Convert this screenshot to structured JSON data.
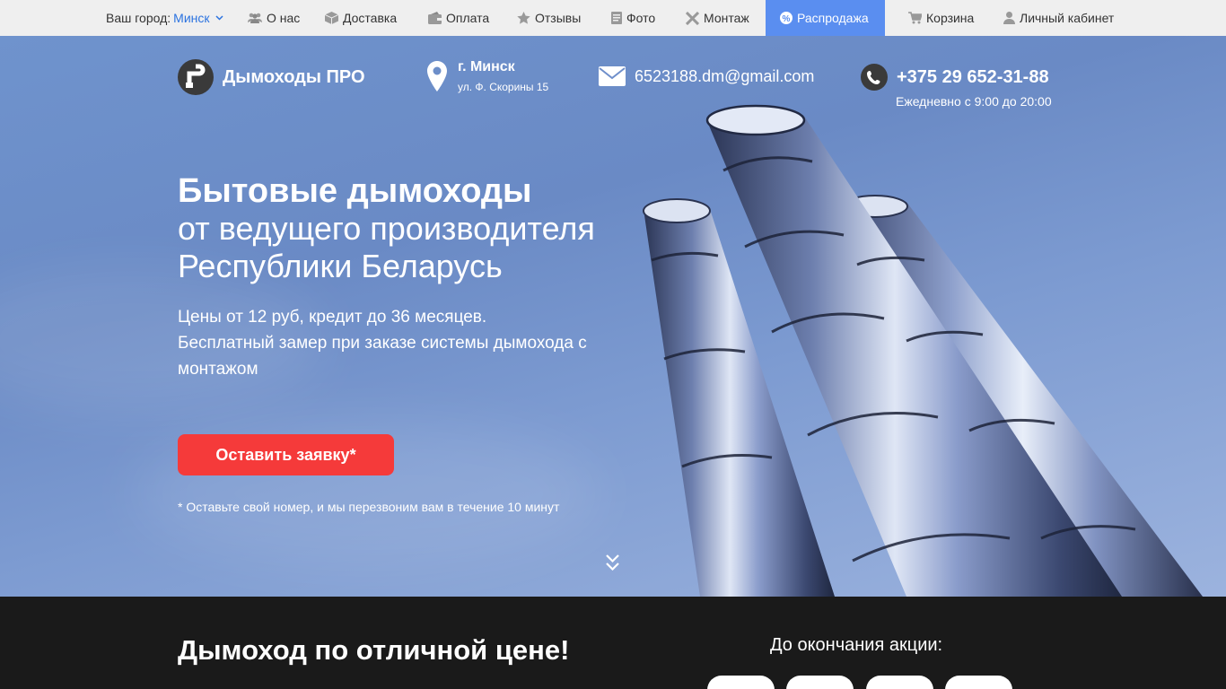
{
  "topnav": {
    "city_label": "Ваш город:",
    "city_value": "Минск",
    "items": [
      {
        "label": "О нас",
        "icon": "users-icon"
      },
      {
        "label": "Доставка",
        "icon": "box-icon"
      },
      {
        "label": "Оплата",
        "icon": "wallet-icon"
      },
      {
        "label": "Отзывы",
        "icon": "star-icon"
      },
      {
        "label": "Фото",
        "icon": "photo-icon"
      },
      {
        "label": "Монтаж",
        "icon": "tools-icon"
      },
      {
        "label": "Распродажа",
        "icon": "sale-icon"
      },
      {
        "label": "Корзина",
        "icon": "cart-icon"
      },
      {
        "label": "Личный кабинет",
        "icon": "user-icon"
      }
    ]
  },
  "header": {
    "brand_name": "Дымоходы ПРО",
    "location_city": "г. Минск",
    "location_street": "ул. Ф. Скорины 15",
    "email": "6523188.dm@gmail.com",
    "phone": "+375 29 652-31-88",
    "hours": "Ежедневно с 9:00 до 20:00"
  },
  "hero": {
    "title_bold": "Бытовые дымоходы",
    "title_line2": "от ведущего производителя",
    "title_line3": "Республики Беларусь",
    "sub_line1": "Цены от 12 руб, кредит до 36 месяцев.",
    "sub_line2": "Бесплатный замер при заказе системы дымохода с монтажом",
    "cta_label": "Оставить заявку*",
    "note": "* Оставьте свой номер, и мы перезвоним вам в течение 10 минут"
  },
  "promo": {
    "title": "Дымоход по отличной цене!",
    "until_label": "До окончания акции:"
  },
  "colors": {
    "accent_red": "#f53a3a",
    "sale_blue": "#5a8ef0",
    "city_link": "#2b73e0"
  }
}
